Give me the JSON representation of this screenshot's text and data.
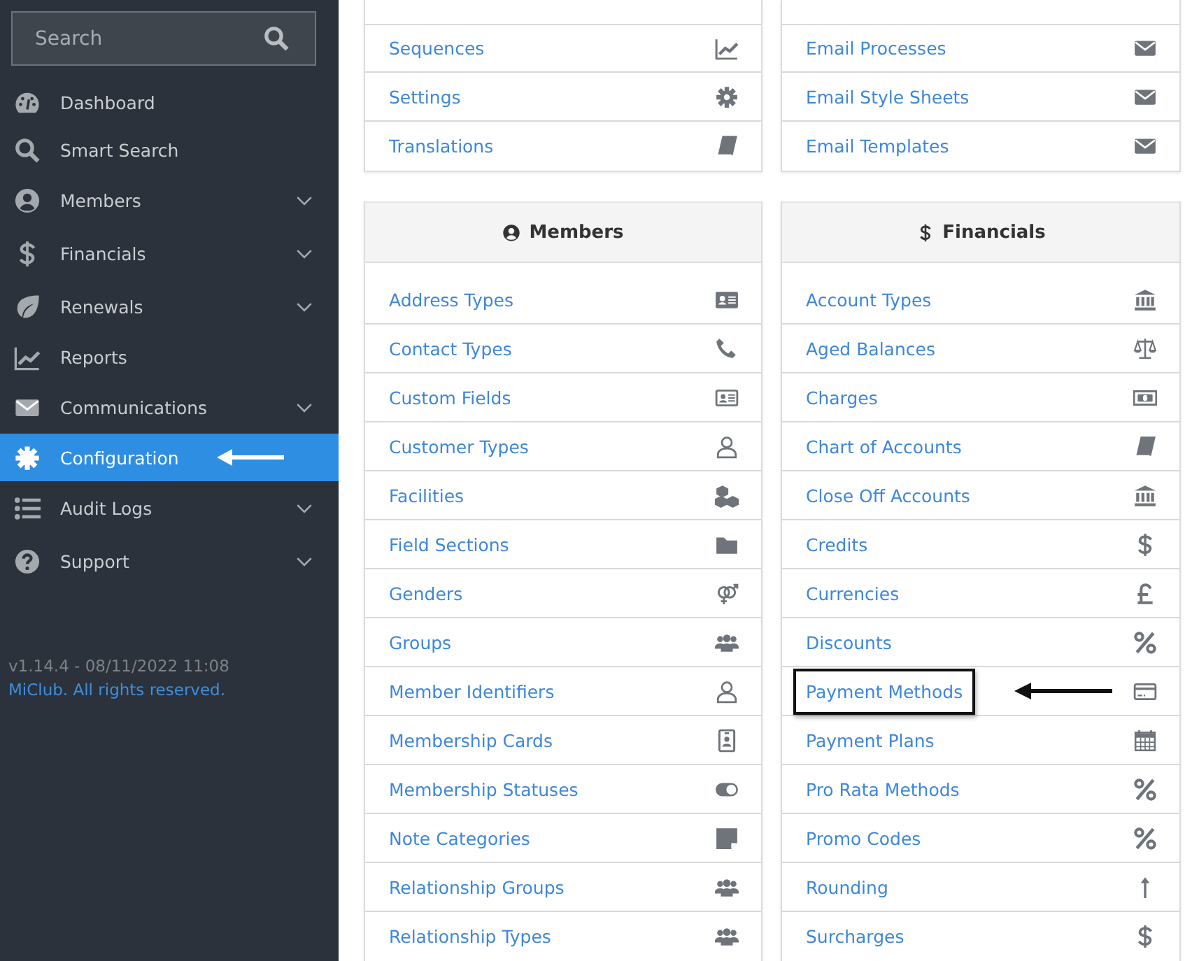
{
  "sidebar": {
    "search": {
      "placeholder": "Search"
    },
    "items": [
      {
        "label": "Dashboard",
        "expandable": false,
        "selected": false,
        "arrow": false
      },
      {
        "label": "Smart Search",
        "expandable": false,
        "selected": false,
        "arrow": false
      },
      {
        "label": "Members",
        "expandable": true,
        "selected": false,
        "arrow": false
      },
      {
        "label": "Financials",
        "expandable": true,
        "selected": false,
        "arrow": false
      },
      {
        "label": "Renewals",
        "expandable": true,
        "selected": false,
        "arrow": false
      },
      {
        "label": "Reports",
        "expandable": false,
        "selected": false,
        "arrow": false
      },
      {
        "label": "Communications",
        "expandable": true,
        "selected": false,
        "arrow": false
      },
      {
        "label": "Configuration",
        "expandable": false,
        "selected": true,
        "arrow": true
      },
      {
        "label": "Audit Logs",
        "expandable": true,
        "selected": false,
        "arrow": false
      },
      {
        "label": "Support",
        "expandable": true,
        "selected": false,
        "arrow": false
      }
    ],
    "version": "v1.14.4 - 08/11/2022 11:08",
    "copyright": "MiClub. All rights reserved."
  },
  "cards": [
    {
      "items": [
        {
          "label": "Sequences",
          "boxed": false,
          "arrow": false
        },
        {
          "label": "Settings",
          "boxed": false,
          "arrow": false
        },
        {
          "label": "Translations",
          "boxed": false,
          "arrow": false
        }
      ]
    },
    {
      "items": [
        {
          "label": "Email Processes",
          "boxed": false,
          "arrow": false
        },
        {
          "label": "Email Style Sheets",
          "boxed": false,
          "arrow": false
        },
        {
          "label": "Email Templates",
          "boxed": false,
          "arrow": false
        }
      ]
    },
    {
      "title": "Members",
      "items": [
        {
          "label": "Address Types",
          "boxed": false,
          "arrow": false
        },
        {
          "label": "Contact Types",
          "boxed": false,
          "arrow": false
        },
        {
          "label": "Custom Fields",
          "boxed": false,
          "arrow": false
        },
        {
          "label": "Customer Types",
          "boxed": false,
          "arrow": false
        },
        {
          "label": "Facilities",
          "boxed": false,
          "arrow": false
        },
        {
          "label": "Field Sections",
          "boxed": false,
          "arrow": false
        },
        {
          "label": "Genders",
          "boxed": false,
          "arrow": false
        },
        {
          "label": "Groups",
          "boxed": false,
          "arrow": false
        },
        {
          "label": "Member Identifiers",
          "boxed": false,
          "arrow": false
        },
        {
          "label": "Membership Cards",
          "boxed": false,
          "arrow": false
        },
        {
          "label": "Membership Statuses",
          "boxed": false,
          "arrow": false
        },
        {
          "label": "Note Categories",
          "boxed": false,
          "arrow": false
        },
        {
          "label": "Relationship Groups",
          "boxed": false,
          "arrow": false
        },
        {
          "label": "Relationship Types",
          "boxed": false,
          "arrow": false
        }
      ]
    },
    {
      "title": "Financials",
      "items": [
        {
          "label": "Account Types",
          "boxed": false,
          "arrow": false
        },
        {
          "label": "Aged Balances",
          "boxed": false,
          "arrow": false
        },
        {
          "label": "Charges",
          "boxed": false,
          "arrow": false
        },
        {
          "label": "Chart of Accounts",
          "boxed": false,
          "arrow": false
        },
        {
          "label": "Close Off Accounts",
          "boxed": false,
          "arrow": false
        },
        {
          "label": "Credits",
          "boxed": false,
          "arrow": false
        },
        {
          "label": "Currencies",
          "boxed": false,
          "arrow": false
        },
        {
          "label": "Discounts",
          "boxed": false,
          "arrow": false
        },
        {
          "label": "Payment Methods",
          "boxed": true,
          "arrow": true
        },
        {
          "label": "Payment Plans",
          "boxed": false,
          "arrow": false
        },
        {
          "label": "Pro Rata Methods",
          "boxed": false,
          "arrow": false
        },
        {
          "label": "Promo Codes",
          "boxed": false,
          "arrow": false
        },
        {
          "label": "Rounding",
          "boxed": false,
          "arrow": false
        },
        {
          "label": "Surcharges",
          "boxed": false,
          "arrow": false
        }
      ]
    }
  ]
}
